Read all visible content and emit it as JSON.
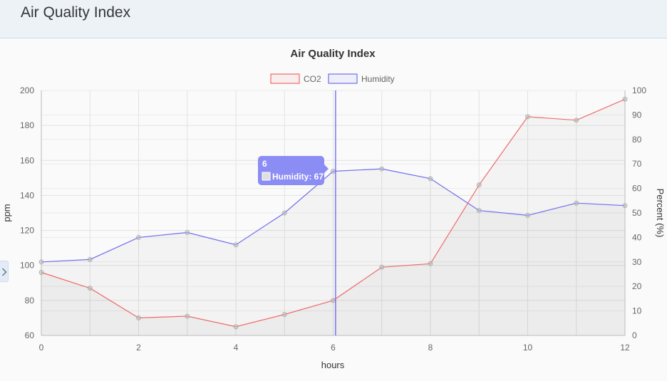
{
  "header": {
    "title": "Air Quality Index"
  },
  "sidebar_toggle": {
    "icon": "chevron-right-icon"
  },
  "chart_data": {
    "type": "line",
    "title": "Air Quality Index",
    "xlabel": "hours",
    "ylabel_left": "ppm",
    "ylabel_right": "Percent (%)",
    "x": [
      0,
      1,
      2,
      3,
      4,
      5,
      6,
      7,
      8,
      9,
      10,
      11,
      12
    ],
    "x_ticks": [
      "0",
      "2",
      "4",
      "6",
      "8",
      "10",
      "12"
    ],
    "y_left_ticks": [
      "60",
      "80",
      "100",
      "120",
      "140",
      "160",
      "180",
      "200"
    ],
    "y_right_ticks": [
      "0",
      "10",
      "20",
      "30",
      "40",
      "50",
      "60",
      "70",
      "80",
      "90",
      "100"
    ],
    "xlim": [
      0,
      12
    ],
    "ylim_left": [
      60,
      200
    ],
    "ylim_right": [
      0,
      100
    ],
    "grid": true,
    "legend_position": "top",
    "series": [
      {
        "name": "CO2",
        "axis": "left",
        "color": "#f06a6a",
        "values": [
          96,
          87,
          70,
          71,
          65,
          72,
          80,
          99,
          101,
          146,
          185,
          183,
          195
        ]
      },
      {
        "name": "Humidity",
        "axis": "right",
        "color": "#6e6ef0",
        "values": [
          30,
          31,
          40,
          42,
          37,
          50,
          67,
          68,
          64,
          51,
          49,
          54,
          53
        ]
      }
    ],
    "tooltip": {
      "title": "6",
      "label": "Humidity: 67",
      "x": 6.05,
      "color": "#8c8cf5"
    }
  }
}
